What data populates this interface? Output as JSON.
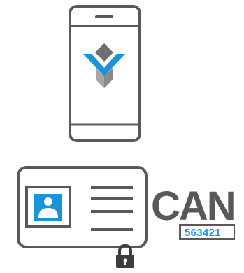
{
  "colors": {
    "stroke": "#595959",
    "accent": "#1a94d6",
    "logo_gray": "#6f6f6f",
    "logo_light": "#a6a6a6"
  },
  "icons": {
    "phone": "smartphone-icon",
    "logo": "app-logo-icon",
    "card": "id-card-icon",
    "portrait": "person-portrait-icon",
    "lock": "padlock-icon"
  },
  "can": {
    "label": "CAN",
    "number": "563421"
  }
}
